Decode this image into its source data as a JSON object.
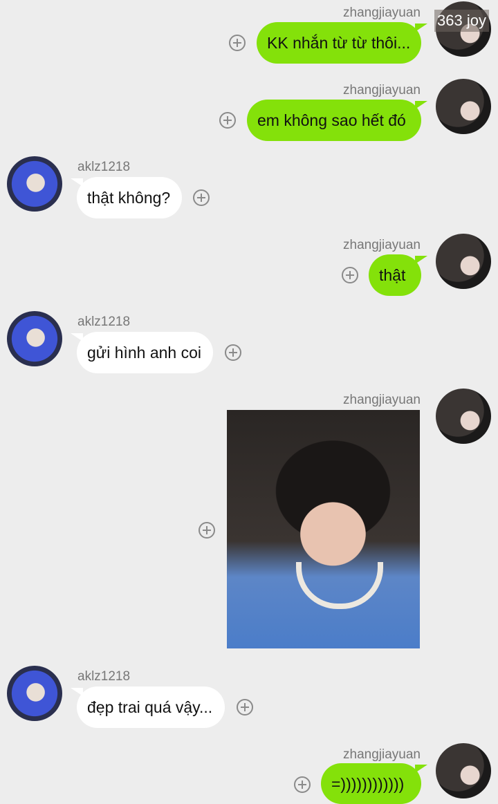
{
  "overlay": {
    "watermark": "363 joy"
  },
  "messages": [
    {
      "sender": "zhangjiayuan",
      "text": "KK nhắn từ từ thôi..."
    },
    {
      "sender": "zhangjiayuan",
      "text": "em không sao hết đó"
    },
    {
      "sender": "aklz1218",
      "text": "thật không?"
    },
    {
      "sender": "zhangjiayuan",
      "text": "thật"
    },
    {
      "sender": "aklz1218",
      "text": "gửi hình anh coi"
    },
    {
      "sender": "zhangjiayuan",
      "text": ""
    },
    {
      "sender": "aklz1218",
      "text": "đẹp trai quá vậy..."
    },
    {
      "sender": "zhangjiayuan",
      "text": "=))))))))))))"
    }
  ],
  "colors": {
    "background": "#ededed",
    "sent_bubble": "#84e10a",
    "received_bubble": "#ffffff",
    "name_text": "#777777"
  }
}
